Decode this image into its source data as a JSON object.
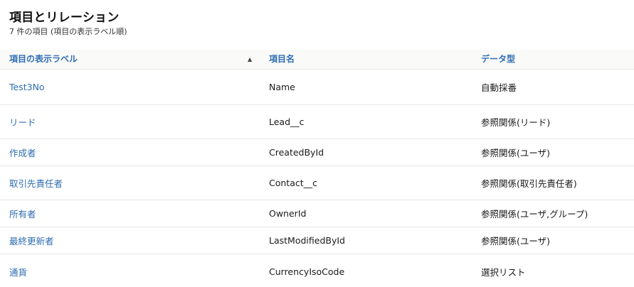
{
  "header": {
    "title": "項目とリレーション",
    "subtitle": "7 件の項目 (項目の表示ラベル順)"
  },
  "table": {
    "columns": [
      "項目の表示ラベル",
      "項目名",
      "データ型"
    ],
    "sort_icon": "sort-ascending-icon",
    "rows": [
      {
        "label": "Test3No",
        "api_name": "Name",
        "type": "自動採番"
      },
      {
        "label": "リード",
        "api_name": "Lead__c",
        "type": "参照関係(リード)"
      },
      {
        "label": "作成者",
        "api_name": "CreatedById",
        "type": "参照関係(ユーザ)"
      },
      {
        "label": "取引先責任者",
        "api_name": "Contact__c",
        "type": "参照関係(取引先責任者)"
      },
      {
        "label": "所有者",
        "api_name": "OwnerId",
        "type": "参照関係(ユーザ,グループ)"
      },
      {
        "label": "最終更新者",
        "api_name": "LastModifiedById",
        "type": "参照関係(ユーザ)"
      },
      {
        "label": "通貨",
        "api_name": "CurrencyIsoCode",
        "type": "選択リスト"
      }
    ]
  },
  "colors": {
    "link": "#2e6db0",
    "header_link": "#2f6db4",
    "header_bg": "#fafaf9",
    "divider": "#e5e5e5"
  }
}
